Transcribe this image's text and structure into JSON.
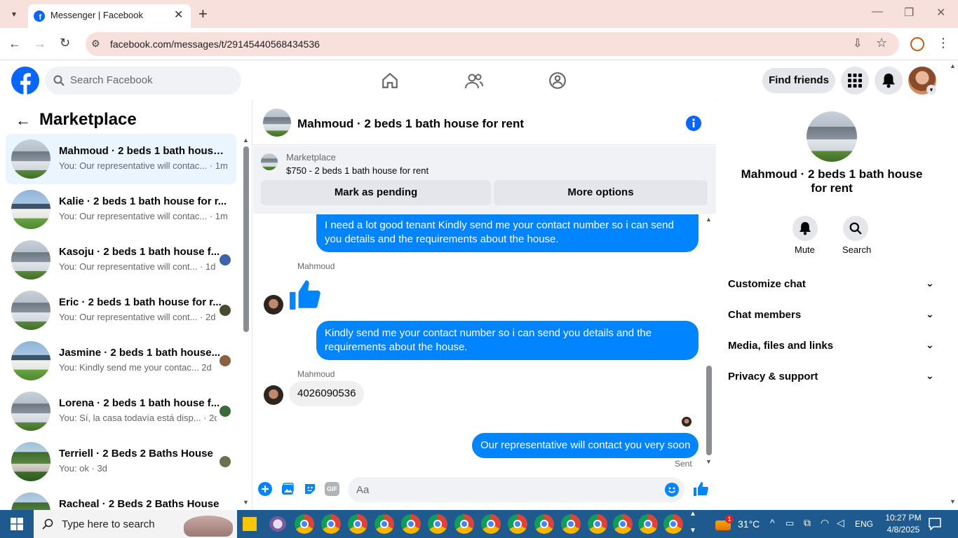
{
  "browser": {
    "tab_title": "Messenger | Facebook",
    "url": "facebook.com/messages/t/29145440568434536"
  },
  "header": {
    "search_placeholder": "Search Facebook",
    "find_friends": "Find friends"
  },
  "left": {
    "title": "Marketplace",
    "conversations": [
      {
        "title": "Mahmoud · 2 beds 1 bath house...",
        "sub": "You: Our representative will contac... · 1m"
      },
      {
        "title": "Kalie · 2 beds 1 bath house for r...",
        "sub": "You: Our representative will contac... · 1m"
      },
      {
        "title": "Kasoju · 2 beds 1 bath house f...",
        "sub": "You: Our representative will cont... · 1d"
      },
      {
        "title": "Eric · 2 beds 1 bath house for r...",
        "sub": "You: Our representative will cont... · 2d"
      },
      {
        "title": "Jasmine · 2 beds 1 bath house...",
        "sub": "You: Kindly send me your contac... 2d"
      },
      {
        "title": "Lorena · 2 beds 1 bath house f...",
        "sub": "You: Sí, la casa todavía está disp... · 2d"
      },
      {
        "title": "Terriell · 2 Beds 2 Baths House",
        "sub": "You: ok · 3d"
      },
      {
        "title": "Racheal · 2 Beds 2 Baths House",
        "sub": ""
      }
    ]
  },
  "chat": {
    "title": "Mahmoud · 2 beds 1 bath house for rent",
    "listing_source": "Marketplace",
    "listing_price": "$750 - 2 beds 1 bath house for rent",
    "mark_pending": "Mark as pending",
    "more_options": "More options",
    "msg1": "I need a lot good tenant Kindly send me your contact number so i can send you details and the requirements about the house.",
    "sender1": "Mahmoud",
    "msg2": "Kindly send me your contact number so i can send you details and the requirements about the house.",
    "sender2": "Mahmoud",
    "msg3": "4026090536",
    "msg4": "Our representative will contact you very soon",
    "sent": "Sent",
    "input_placeholder": "Aa"
  },
  "right": {
    "title": "Mahmoud · 2 beds 1 bath house for rent",
    "mute": "Mute",
    "search": "Search",
    "sections": [
      "Customize chat",
      "Chat members",
      "Media, files and links",
      "Privacy & support"
    ]
  },
  "taskbar": {
    "search_placeholder": "Type here to search",
    "temp": "31°C",
    "lang": "ENG",
    "time": "10:27 PM",
    "date": "4/8/2025",
    "weather_badge": "1"
  },
  "colors": {
    "fb_blue": "#0866ff",
    "bubble_blue": "#0084ff",
    "tab_bg": "#f8e1dd",
    "taskbar": "#1e5a8e"
  }
}
